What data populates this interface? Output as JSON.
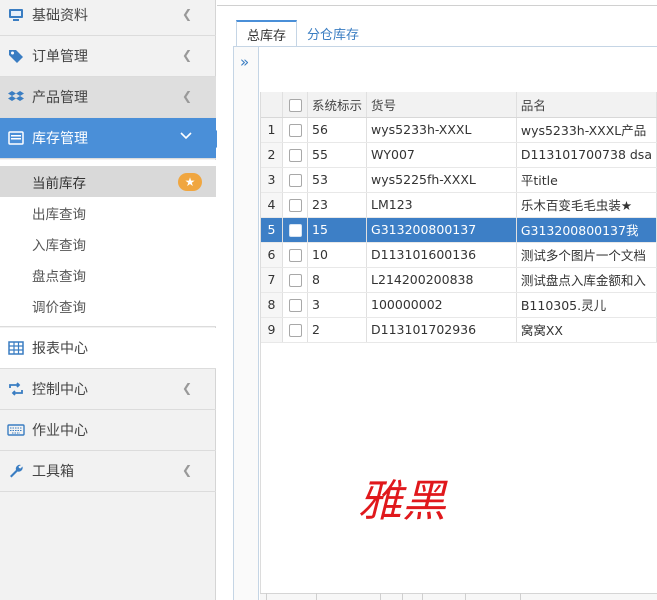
{
  "sidebar": {
    "items": [
      {
        "label": "基础资料",
        "icon": "monitor-icon"
      },
      {
        "label": "订单管理",
        "icon": "tags-icon"
      },
      {
        "label": "产品管理",
        "icon": "dropbox-icon"
      },
      {
        "label": "库存管理",
        "icon": "list-icon"
      },
      {
        "label": "报表中心",
        "icon": "table-icon"
      },
      {
        "label": "控制中心",
        "icon": "retweet-icon"
      },
      {
        "label": "作业中心",
        "icon": "keyboard-icon"
      },
      {
        "label": "工具箱",
        "icon": "wrench-icon"
      }
    ],
    "submenu": [
      {
        "label": "当前库存"
      },
      {
        "label": "出库查询"
      },
      {
        "label": "入库查询"
      },
      {
        "label": "盘点查询"
      },
      {
        "label": "调价查询"
      }
    ],
    "star": "★"
  },
  "tabs": [
    {
      "label": "总库存"
    },
    {
      "label": "分仓库存"
    }
  ],
  "expand_glyph": "»",
  "grid": {
    "headers": [
      "系统标示",
      "货号",
      "品名"
    ],
    "rows": [
      {
        "n": "1",
        "id": "56",
        "sku": "wys5233h-XXXL",
        "name": "wys5233h-XXXL产品"
      },
      {
        "n": "2",
        "id": "55",
        "sku": "WY007",
        "name": "D113101700738 dsa"
      },
      {
        "n": "3",
        "id": "53",
        "sku": "wys5225fh-XXXL",
        "name": "平title"
      },
      {
        "n": "4",
        "id": "23",
        "sku": "LM123",
        "name": "乐木百变毛毛虫装★"
      },
      {
        "n": "5",
        "id": "15",
        "sku": "G313200800137",
        "name": "G313200800137我"
      },
      {
        "n": "6",
        "id": "10",
        "sku": "D113101600136",
        "name": "测试多个图片一个文档"
      },
      {
        "n": "7",
        "id": "8",
        "sku": "L214200200838",
        "name": "测试盘点入库金额和入"
      },
      {
        "n": "8",
        "id": "3",
        "sku": "100000002",
        "name": "B110305.灵儿"
      },
      {
        "n": "9",
        "id": "2",
        "sku": "D113101702936",
        "name": "窝窝XX"
      }
    ]
  },
  "watermark": "雅黑",
  "colors": {
    "accent": "#4a8fd8",
    "selected_row": "#3d7fc6",
    "badge": "#f0a640",
    "watermark": "#e0181c"
  }
}
